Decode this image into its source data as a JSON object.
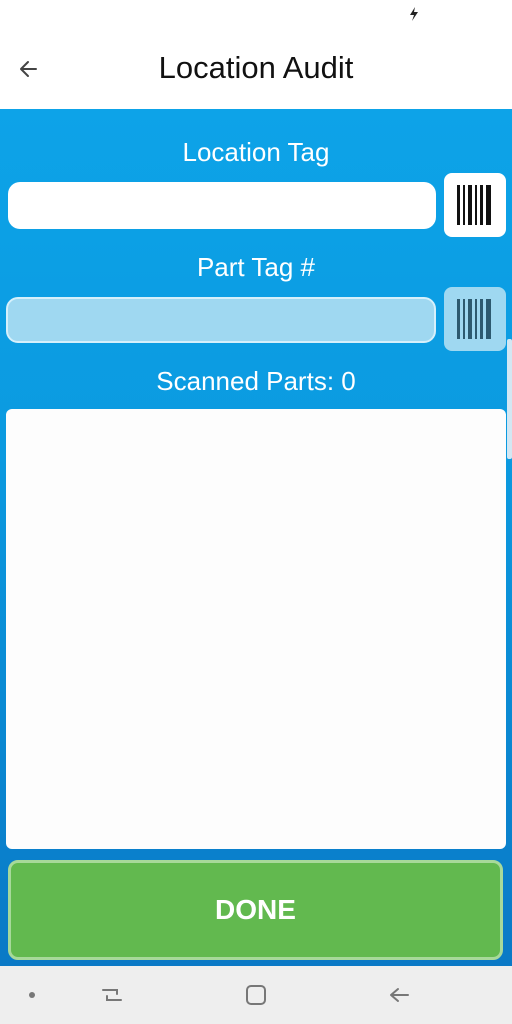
{
  "app_bar": {
    "title": "Location Audit",
    "back_icon": "arrow-left-icon"
  },
  "form": {
    "location_label": "Location Tag",
    "location_value": "",
    "part_label": "Part Tag #",
    "part_value": "",
    "scan_icon": "barcode-icon",
    "scanned_label": "Scanned Parts: 0"
  },
  "actions": {
    "done_label": "DONE"
  },
  "nav": {
    "items": [
      "dot-icon",
      "recent-apps-icon",
      "home-icon",
      "back-icon"
    ]
  },
  "colors": {
    "content_top": "#0da3e8",
    "content_bottom": "#0a79c6",
    "done_button": "#62b94f"
  }
}
